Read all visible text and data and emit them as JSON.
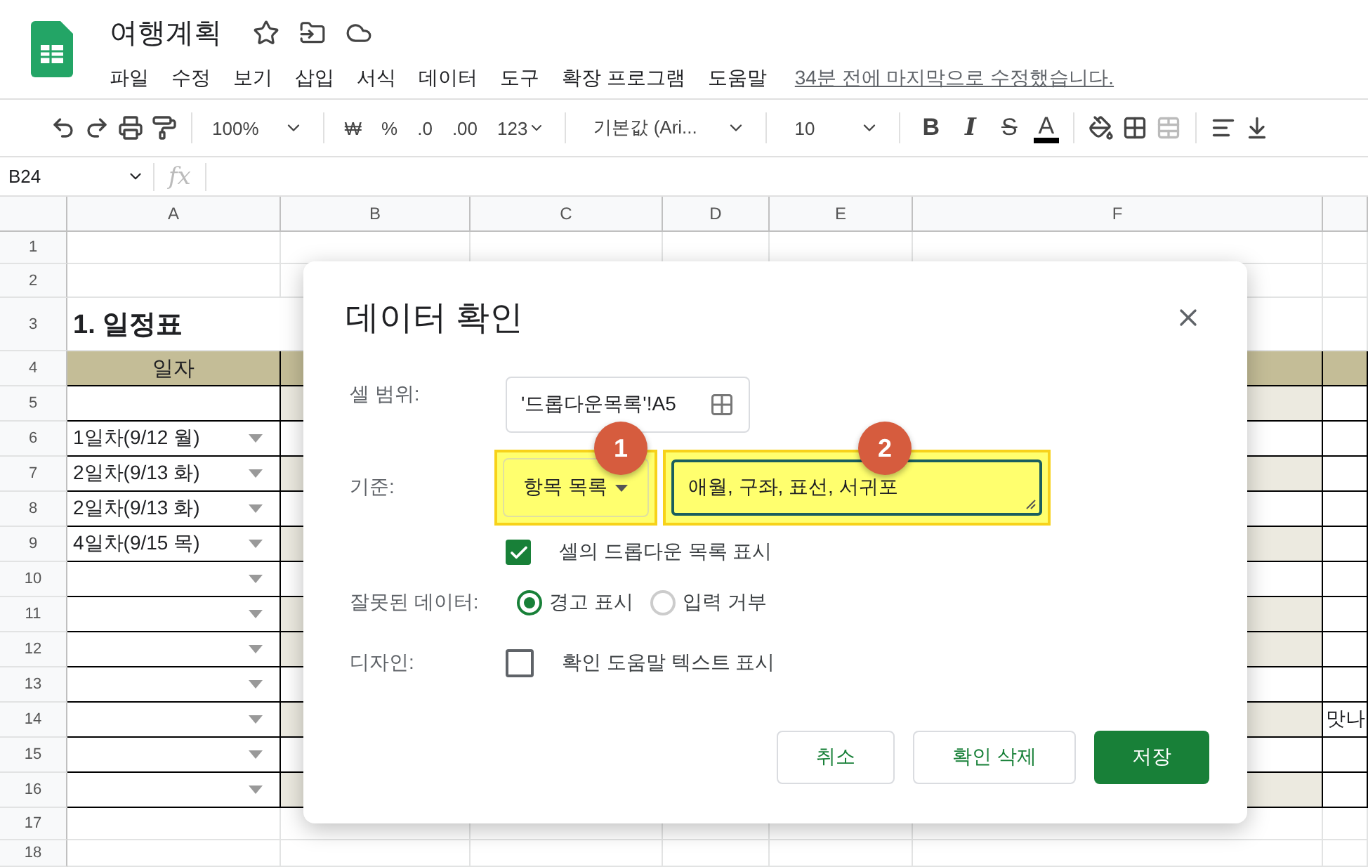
{
  "document": {
    "title": "여행계획",
    "last_edit": "34분 전에 마지막으로 수정했습니다."
  },
  "menu": [
    "파일",
    "수정",
    "보기",
    "삽입",
    "서식",
    "데이터",
    "도구",
    "확장 프로그램",
    "도움말"
  ],
  "toolbar": {
    "zoom": "100%",
    "currency": "₩",
    "percent": "%",
    "decimal_less": ".0",
    "decimal_more": ".00",
    "number_format": "123",
    "font": "기본값 (Ari...",
    "font_size": "10",
    "bold": "B",
    "italic": "I",
    "strikethrough": "S",
    "text_color": "A"
  },
  "formula_bar": {
    "name_box": "B24",
    "fx": "fx"
  },
  "sheet": {
    "columns": [
      "A",
      "B",
      "C",
      "D",
      "E",
      "F"
    ],
    "rows": [
      {
        "number": "1",
        "kind": "blank"
      },
      {
        "number": "2",
        "kind": "blank"
      },
      {
        "number": "3",
        "kind": "title",
        "a": "1. 일정표"
      },
      {
        "number": "4",
        "kind": "header",
        "a": "일자"
      },
      {
        "number": "5",
        "kind": "data",
        "shaded": true,
        "dropdown": false
      },
      {
        "number": "6",
        "kind": "data",
        "shaded": false,
        "dropdown": true,
        "a": "1일차(9/12 월)"
      },
      {
        "number": "7",
        "kind": "data",
        "shaded": true,
        "dropdown": true,
        "a": "2일차(9/13 화)"
      },
      {
        "number": "8",
        "kind": "data",
        "shaded": false,
        "dropdown": true,
        "a": "2일차(9/13 화)"
      },
      {
        "number": "9",
        "kind": "data",
        "shaded": true,
        "dropdown": true,
        "a": "4일차(9/15 목)"
      },
      {
        "number": "10",
        "kind": "data",
        "shaded": false,
        "dropdown": true
      },
      {
        "number": "11",
        "kind": "data",
        "shaded": true,
        "dropdown": true
      },
      {
        "number": "12",
        "kind": "data",
        "shaded": true,
        "dropdown": true
      },
      {
        "number": "13",
        "kind": "data",
        "shaded": false,
        "dropdown": true
      },
      {
        "number": "14",
        "kind": "data",
        "shaded": true,
        "dropdown": true,
        "g": "맛나"
      },
      {
        "number": "15",
        "kind": "data",
        "shaded": false,
        "dropdown": true
      },
      {
        "number": "16",
        "kind": "data",
        "shaded": true,
        "dropdown": true
      },
      {
        "number": "17",
        "kind": "blank"
      },
      {
        "number": "18",
        "kind": "blank"
      }
    ]
  },
  "dialog": {
    "title": "데이터 확인",
    "range": {
      "label": "셀 범위:",
      "value": "'드롭다운목록'!A5"
    },
    "criteria": {
      "label": "기준:",
      "type": "항목 목록",
      "value": "애월, 구좌, 표선, 서귀포",
      "badges": [
        "1",
        "2"
      ]
    },
    "show_dropdown": {
      "label": "셀의 드롭다운 목록 표시",
      "checked": true
    },
    "invalid": {
      "label": "잘못된 데이터:",
      "options": [
        {
          "label": "경고 표시",
          "selected": true
        },
        {
          "label": "입력 거부",
          "selected": false
        }
      ]
    },
    "design": {
      "label": "디자인:",
      "checkbox": {
        "label": "확인 도움말 텍스트 표시",
        "checked": false
      }
    },
    "buttons": [
      {
        "label": "취소",
        "kind": "secondary"
      },
      {
        "label": "확인 삭제",
        "kind": "secondary"
      },
      {
        "label": "저장",
        "kind": "primary"
      }
    ]
  }
}
